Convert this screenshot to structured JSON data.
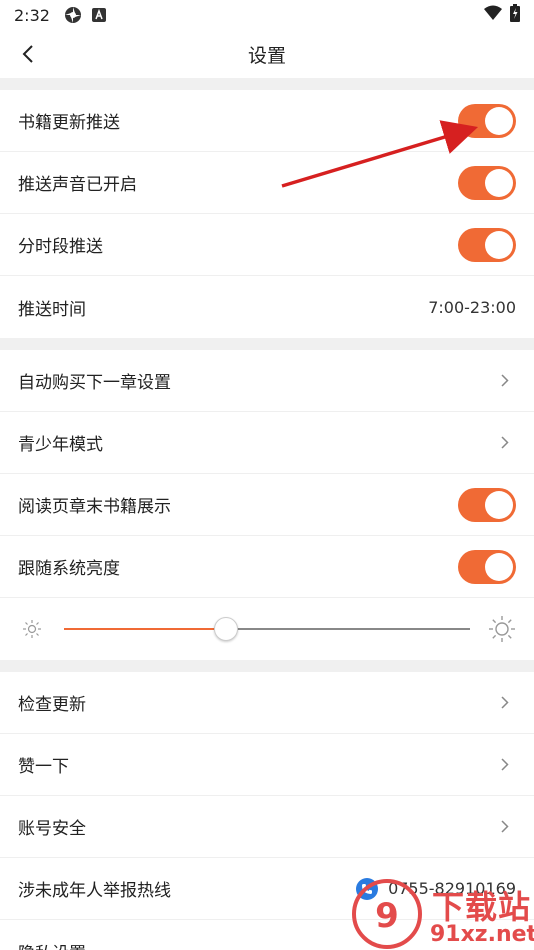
{
  "status_bar": {
    "time": "2:32"
  },
  "header": {
    "title": "设置",
    "back_icon": "chevron-left-icon"
  },
  "group1": {
    "items": [
      {
        "label": "书籍更新推送",
        "toggle_on": true
      },
      {
        "label": "推送声音已开启",
        "toggle_on": true
      },
      {
        "label": "分时段推送",
        "toggle_on": true
      },
      {
        "label": "推送时间",
        "value": "7:00-23:00"
      }
    ]
  },
  "group2": {
    "items": [
      {
        "label": "自动购买下一章设置"
      },
      {
        "label": "青少年模式"
      },
      {
        "label": "阅读页章末书籍展示",
        "toggle_on": true
      },
      {
        "label": "跟随系统亮度",
        "toggle_on": true
      }
    ],
    "brightness": {
      "level": 0.4
    }
  },
  "group3": {
    "items": [
      {
        "label": "检查更新"
      },
      {
        "label": "赞一下"
      },
      {
        "label": "账号安全"
      },
      {
        "label": "涉未成年人举报热线",
        "value": "0755-82910169"
      },
      {
        "label": "隐私设置"
      }
    ]
  },
  "watermark": {
    "top": "下载站",
    "bottom": "91xz.net"
  },
  "colors": {
    "accent": "#f06a35",
    "phone": "#2a7be0",
    "arrow": "#d62020"
  }
}
